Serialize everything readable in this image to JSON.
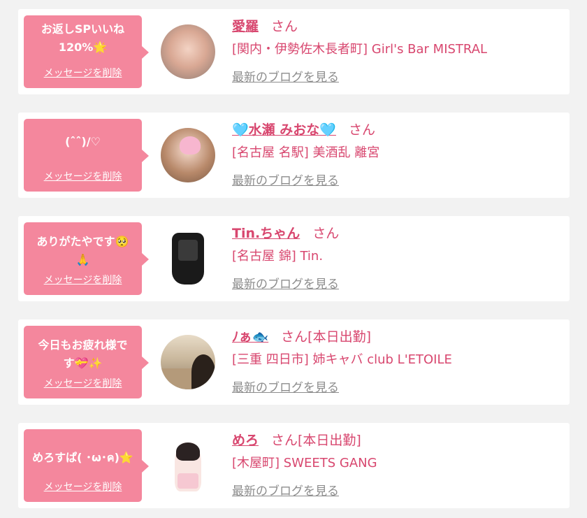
{
  "entries": [
    {
      "message": "お返しSPいいね\n120%🌟",
      "delete_label": "メッセージを削除",
      "name": "愛羅",
      "suffix": "さん",
      "shop": "[関内・伊勢佐木長者町] Girl's Bar MISTRAL",
      "blog_link": "最新のブログを見る"
    },
    {
      "message": "(ˆˆ)/♡",
      "delete_label": "メッセージを削除",
      "name": "🩵水瀬 みおな🩵",
      "suffix": "さん",
      "shop": "[名古屋 名駅] 美酒乱 離宮",
      "blog_link": "最新のブログを見る"
    },
    {
      "message": "ありがたやです🥺\n🙏",
      "delete_label": "メッセージを削除",
      "name": "Tin.ちゃん",
      "suffix": "さん",
      "shop": "[名古屋 錦] Tin.",
      "blog_link": "最新のブログを見る"
    },
    {
      "message": "今日もお疲れ様で\nす💝✨",
      "delete_label": "メッセージを削除",
      "name": "ﾉぁ🐟",
      "suffix": "さん[本日出勤]",
      "shop": "[三重 四日市] 姉キャバ club L'ETOILE",
      "blog_link": "最新のブログを見る"
    },
    {
      "message": "めろすぱ( ･ω･ค)⭐",
      "delete_label": "メッセージを削除",
      "name": "めろ",
      "suffix": "さん[本日出勤]",
      "shop": "[木屋町] SWEETS GANG",
      "blog_link": "最新のブログを見る"
    }
  ],
  "colors": {
    "bubble": "#f4879d",
    "accent_text": "#d8476f",
    "link_gray": "#8c8c8c",
    "background": "#f2f2f2"
  }
}
